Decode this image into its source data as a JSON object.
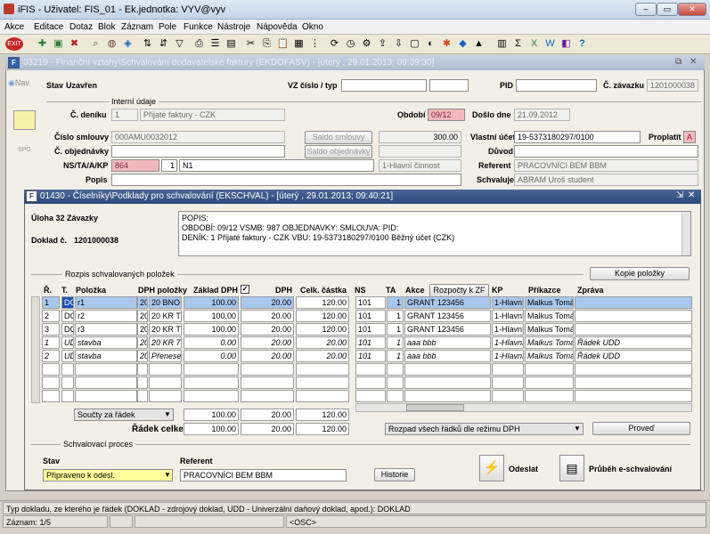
{
  "window": {
    "title": "iFIS - Uživatel: FIS_01 - Ek.jednotka: VYV@vyv",
    "min": "‒",
    "max": "▭",
    "close": "✕"
  },
  "menu": [
    "Akce",
    "Editace",
    "Dotaz",
    "Blok",
    "Záznam",
    "Pole",
    "Funkce",
    "Nástroje",
    "Nápověda",
    "Okno"
  ],
  "main_form": {
    "title": "03219 - Finanční vztahy\\Schvalování dodavatelské faktury (EKDOFASV) - [úterý , 29.01.2013; 09:39:30]",
    "nav": "Nav",
    "stav_label": "Stav",
    "stav_value": "Uzavřen",
    "vz_label": "VZ číslo / typ",
    "vz_value": "",
    "pid_label": "PID",
    "pid_value": "",
    "cislo_zavazku_label": "Č. závazku",
    "cislo_zavazku_value": "1201000038",
    "interni_udaje": "Interní údaje",
    "cislo_deniku_label": "Č. deníku",
    "cislo_deniku_value": "1",
    "cislo_deniku_text": "Přijaté faktury - CZK",
    "obdobi_label": "Období",
    "obdobi_value": "09/12",
    "dosloden_label": "Došlo dne",
    "dosloden_value": "21.09.2012",
    "cislo_smlouvy_label": "Číslo smlouvy",
    "cislo_smlouvy_value": "000AMU0032012",
    "saldo_smlouvy": "Saldo smlouvy",
    "saldo_smlouvy_value": "300.00",
    "vlastni_ucet_label": "Vlastní účet",
    "vlastni_ucet_value": "19-5373180297/0100",
    "proplatit_label": "Proplatit",
    "proplatit_value": "A",
    "cislo_objednavky_label": "Č. objednávky",
    "cislo_objednavky_value": "",
    "saldo_objednavky": "Saldo objednávky",
    "duvod_label": "Důvod",
    "duvod_value": "",
    "ns_label": "NS/TA/A/KP",
    "ns_value": "864",
    "ta_value": "1",
    "a_value": "N1",
    "kp_value": "1-Hlavní činnost",
    "referent_label": "Referent",
    "referent_value": "PRACOVNÍCI BEM BBM",
    "popis_label": "Popis",
    "popis_value": "",
    "schvaluje_label": "Schvaluje",
    "schvaluje_value": "ABRAM Uroš student",
    "side_btn2": "SPG"
  },
  "sub_form": {
    "title": "01430 - Číselníky\\Podklady pro schvalování (EKSCHVAL) - [úterý , 29.01.2013; 09:40:21]",
    "uloha": "Úloha 32 Závazky",
    "doklad_label": "Doklad č.",
    "doklad_value": "1201000038",
    "popis_lines": [
      "POPIS:",
      "OBDOBÍ: 09/12 VSMB: 987 OBJEDNAVKY:  SMLOUVA:  PID:",
      "DENÍK: 1 Přijaté faktury - CZK VBU: 19-5373180297/0100 Běžný účet (CZK)"
    ],
    "rozpis": "Rozpis schvalovaných položek",
    "kopie": "Kopie položky",
    "headers": {
      "r": "Ř.",
      "t": "T.",
      "polozka": "Položka",
      "dph_polozky": "DPH položky",
      "zaklad": "Základ DPH",
      "check": "✓",
      "dph": "DPH",
      "celk": "Celk. částka",
      "ns": "NS",
      "ta": "TA",
      "akce": "Akce",
      "rozpocty": "Rozpočty k ZF",
      "kp": "KP",
      "prikazce": "Příkazce",
      "zprava": "Zpráva"
    },
    "rows": [
      {
        "r": "1",
        "t": "DC",
        "pol": "r1",
        "d1": "20",
        "d2": "20 BNO",
        "zak": "100.00",
        "dph": "20.00",
        "celk": "120.00",
        "ns": "101",
        "ta": "1",
        "akce": "GRANT 123456",
        "kp": "1-Hlavní",
        "pri": "Malkus Tomáš",
        "zpr": "",
        "it": false
      },
      {
        "r": "2",
        "t": "DC",
        "pol": "r2",
        "d1": "20",
        "d2": "20 KR Tu",
        "zak": "100.00",
        "dph": "20.00",
        "celk": "120.00",
        "ns": "101",
        "ta": "1",
        "akce": "GRANT 123456",
        "kp": "1-Hlavní",
        "pri": "Malkus Tomáš",
        "zpr": "",
        "it": false
      },
      {
        "r": "3",
        "t": "DC",
        "pol": "r3",
        "d1": "20",
        "d2": "20 KR Tu",
        "zak": "100.00",
        "dph": "20.00",
        "celk": "120.00",
        "ns": "101",
        "ta": "1",
        "akce": "GRANT 123456",
        "kp": "1-Hlavní",
        "pri": "Malkus Tomáš",
        "zpr": "",
        "it": false
      },
      {
        "r": "1",
        "t": "UD",
        "pol": "stavba",
        "d1": "20",
        "d2": "20 KR 7",
        "zak": "0.00",
        "dph": "20.00",
        "celk": "20.00",
        "ns": "101",
        "ta": "1",
        "akce": "aaa bbb",
        "kp": "1-Hlavní",
        "pri": "Malkus Tomáš",
        "zpr": "Řádek UDD",
        "it": true
      },
      {
        "r": "2",
        "t": "UD",
        "pol": "stavba",
        "d1": "20",
        "d2": "Přenese",
        "zak": "0.00",
        "dph": "20.00",
        "celk": "20.00",
        "ns": "101",
        "ta": "1",
        "akce": "aaa bbb",
        "kp": "1-Hlavní",
        "pri": "Malkus Tomáš",
        "zpr": "Řádek UDD",
        "it": true
      }
    ],
    "soucty": "Součty za řádek",
    "soucty_zak": "100.00",
    "soucty_dph": "20.00",
    "soucty_celk": "120.00",
    "radek_celkem": "Řádek celkem",
    "rc_zak": "100.00",
    "rc_dph": "20.00",
    "rc_celk": "120.00",
    "rozpad": "Rozpad všech řádků dle režimu DPH",
    "proved": "Proveď",
    "schval_proces": "Schvalovací proces",
    "stav_label": "Stav",
    "stav_value": "Připraveno k odesl.",
    "referent_label": "Referent",
    "referent_value": "PRACOVNÍCI BEM BBM",
    "historie": "Historie",
    "odeslat": "Odeslat",
    "prubeh": "Průběh e-schvalování"
  },
  "status": {
    "hint": "Typ dokladu, ze kterého je řádek (DOKLAD - zdrojový doklad, UDD - Univerzální daňový doklad, apod.): DOKLAD",
    "zaznam": "Záznam: 1/5",
    "osc": "<OSC>"
  },
  "colors": {
    "pink": "#f3b8bd",
    "selected": "#a9c8ef",
    "subtitle": "#2c477a"
  }
}
